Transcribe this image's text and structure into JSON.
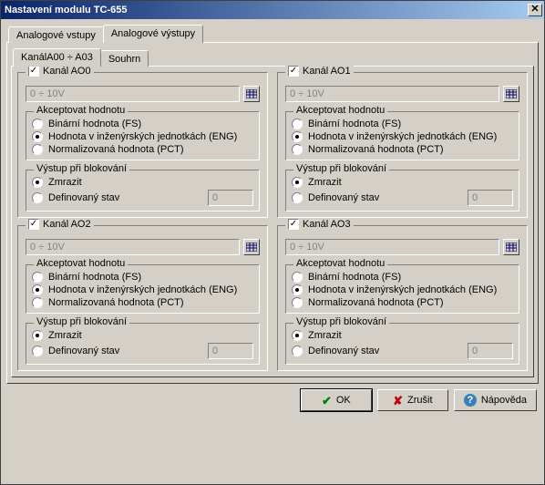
{
  "window": {
    "title": "Nastavení modulu TC-655"
  },
  "outer_tabs": {
    "inputs_label": "Analogové vstupy",
    "outputs_label": "Analogové výstupy"
  },
  "inner_tabs": {
    "channels_label": "KanálA00 ÷ A03",
    "summary_label": "Souhrn"
  },
  "group_labels": {
    "accept_value": "Akceptovat hodnotu",
    "output_on_block": "Výstup při blokování"
  },
  "accept_options": {
    "binary": "Binární hodnota (FS)",
    "eng": "Hodnota v inženýrských jednotkách (ENG)",
    "normalized": "Normalizovaná hodnota (PCT)"
  },
  "block_options": {
    "freeze": "Zmrazit",
    "defined": "Definovaný stav"
  },
  "channels": [
    {
      "title": "Kanál AO0",
      "range": "0 ÷ 10V",
      "defined_value": "0"
    },
    {
      "title": "Kanál AO1",
      "range": "0 ÷ 10V",
      "defined_value": "0"
    },
    {
      "title": "Kanál AO2",
      "range": "0 ÷ 10V",
      "defined_value": "0"
    },
    {
      "title": "Kanál AO3",
      "range": "0 ÷ 10V",
      "defined_value": "0"
    }
  ],
  "buttons": {
    "ok": "OK",
    "cancel": "Zrušit",
    "help": "Nápověda"
  }
}
